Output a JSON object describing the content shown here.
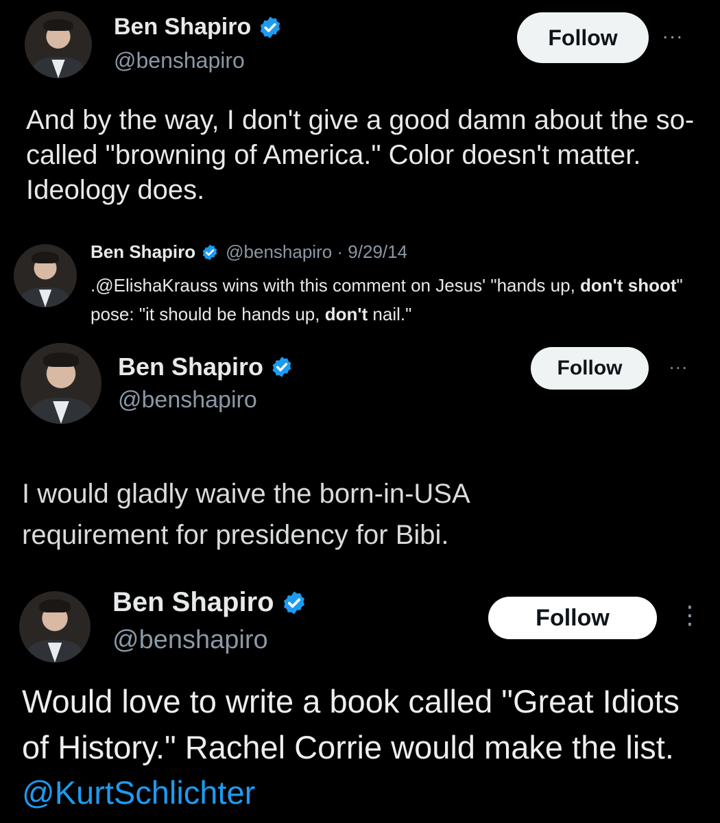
{
  "tweet1": {
    "name": "Ben Shapiro",
    "handle": "@benshapiro",
    "follow": "Follow",
    "more": "...",
    "text": "And by the way, I don't give a good damn about the so-called \"browning of America.\" Color doesn't matter. Ideology does."
  },
  "tweet2": {
    "name": "Ben Shapiro",
    "handle_date": "@benshapiro · 9/29/14",
    "text_a": ".@ElishaKrauss wins with this comment on Jesus' \"hands up, ",
    "bold_a": "don't",
    "text_b": " ",
    "bold_b": "shoot",
    "text_c": "\" pose: \"it should be hands up, ",
    "bold_c": "don't",
    "text_d": " nail.\""
  },
  "tweet3": {
    "name": "Ben Shapiro",
    "handle": "@benshapiro",
    "follow": "Follow",
    "more": "...",
    "text": "I would gladly waive the born-in-USA requirement for presidency for Bibi."
  },
  "tweet4": {
    "name": "Ben Shapiro",
    "handle": "@benshapiro",
    "follow": "Follow",
    "more": "⋮",
    "text": "Would love to write a book called \"Great Idiots of History.\" Rachel Corrie would make the list. ",
    "mention": "@KurtSchlichter"
  },
  "colors": {
    "background": "#000000",
    "text": "#e7e9ea",
    "secondary": "#8b98a5",
    "link": "#1d9bf0",
    "verified": "#1d9bf0",
    "button": "#eff3f4"
  }
}
